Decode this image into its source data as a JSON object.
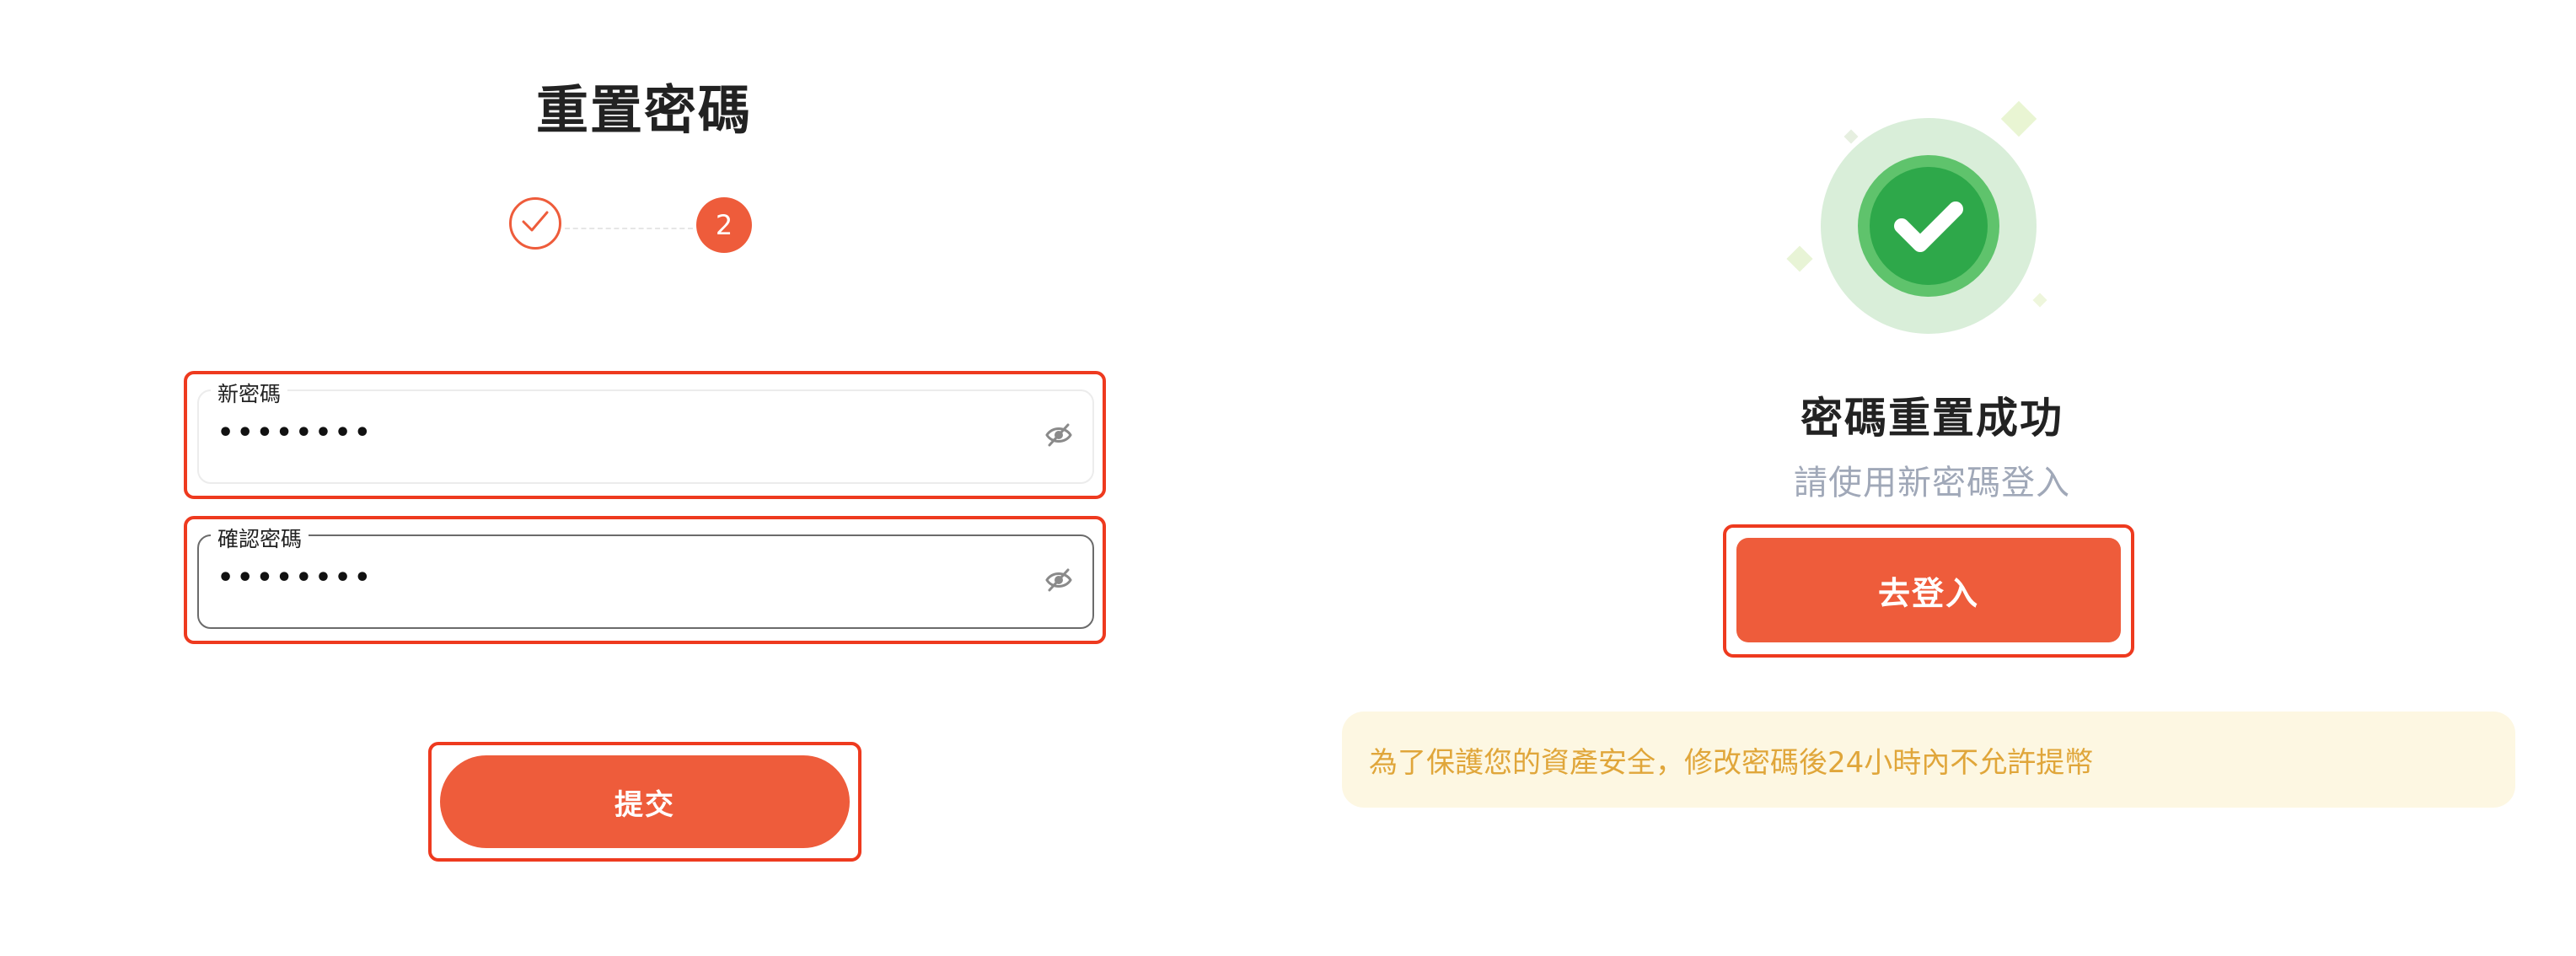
{
  "left_panel": {
    "title": "重置密碼",
    "steps": [
      {
        "state": "done",
        "icon": "check-icon"
      },
      {
        "state": "current",
        "label": "2"
      }
    ],
    "new_password": {
      "label": "新密碼",
      "value": "••••••••",
      "toggle_icon": "eye-off-icon"
    },
    "confirm_password": {
      "label": "確認密碼",
      "value": "••••••••",
      "toggle_icon": "eye-off-icon"
    },
    "submit_label": "提交"
  },
  "right_panel": {
    "success_icon": "success-check-icon",
    "title": "密碼重置成功",
    "subtitle": "請使用新密碼登入",
    "login_label": "去登入",
    "notice": "為了保護您的資產安全，修改密碼後24小時內不允許提幣"
  },
  "colors": {
    "accent": "#ee5c3b",
    "highlight_border": "#ee3a1f",
    "success_green": "#4cbf5f",
    "notice_text": "#e0a63a",
    "notice_bg": "#fdf7e2"
  }
}
